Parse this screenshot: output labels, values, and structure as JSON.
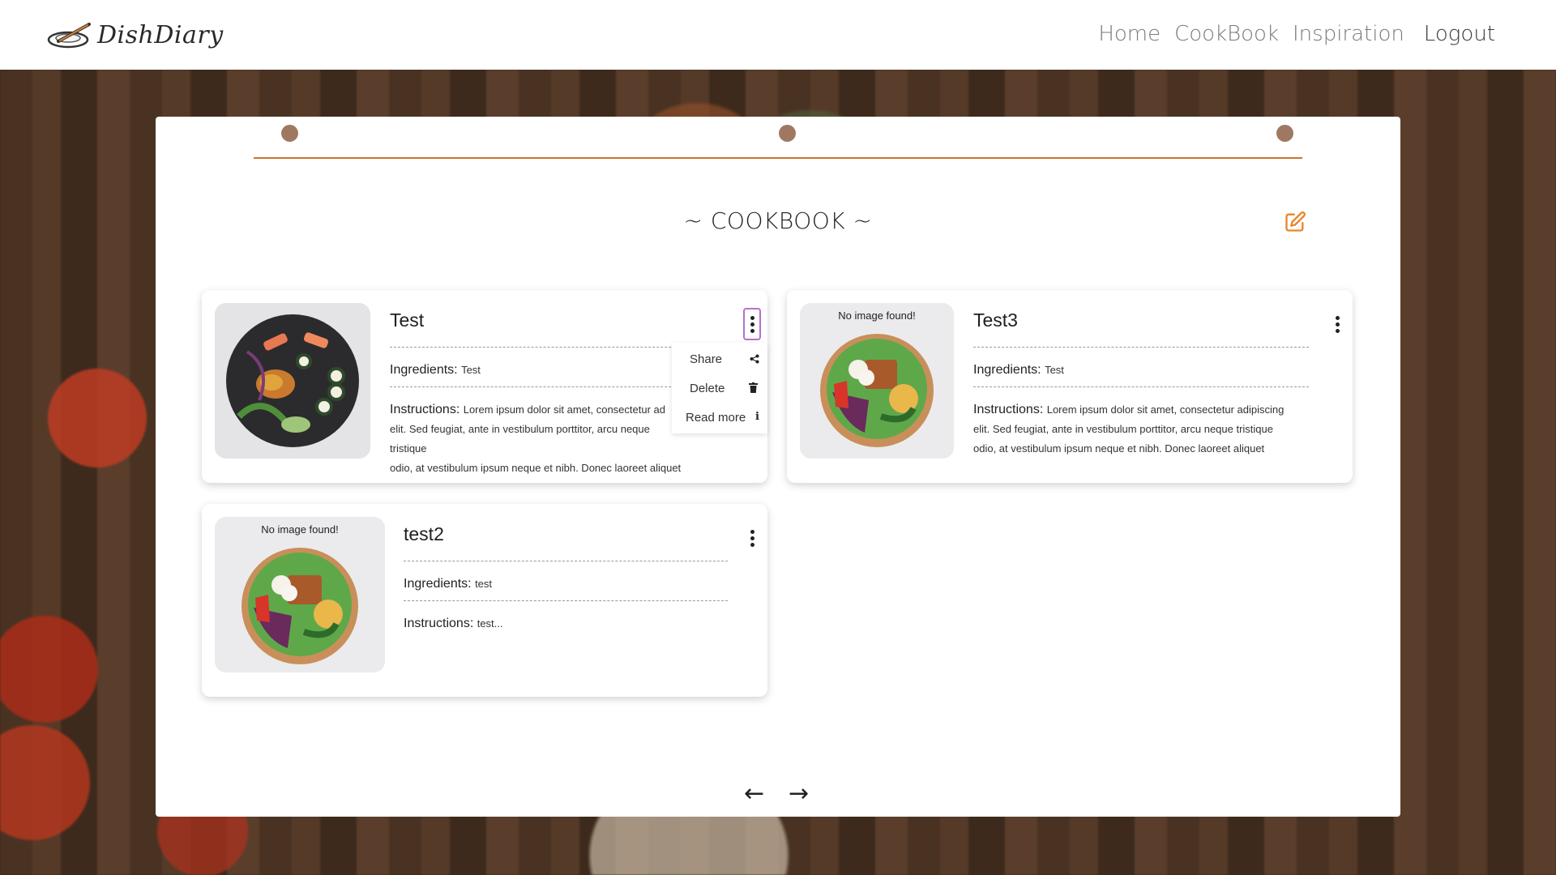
{
  "brand": {
    "name": "DishDiary"
  },
  "nav": {
    "home": "Home",
    "cookbook": "CookBook",
    "inspiration": "Inspiration",
    "logout": "Logout"
  },
  "page": {
    "title": "~ COOKBOOK ~"
  },
  "recipes": [
    {
      "title": "Test",
      "ingredients_label": "Ingredients:",
      "ingredients": "Test",
      "instructions_label": "Instructions:",
      "instructions_line1": "Lorem ipsum dolor sit amet, consectetur ad",
      "instructions_line2": "elit. Sed feugiat, ante in vestibulum porttitor, arcu neque tristique",
      "instructions_line3": "odio, at vestibulum ipsum neque et nibh. Donec laoreet aliquet",
      "image_note": ""
    },
    {
      "title": "Test3",
      "ingredients_label": "Ingredients:",
      "ingredients": "Test",
      "instructions_label": "Instructions:",
      "instructions_line1": "Lorem ipsum dolor sit amet, consectetur adipiscing",
      "instructions_line2": "elit. Sed feugiat, ante in vestibulum porttitor, arcu neque tristique",
      "instructions_line3": "odio, at vestibulum ipsum neque et nibh. Donec laoreet aliquet",
      "image_note": "No image found!"
    },
    {
      "title": "test2",
      "ingredients_label": "Ingredients:",
      "ingredients": "test",
      "instructions_label": "Instructions:",
      "instructions_line1": "test...",
      "image_note": "No image found!"
    }
  ],
  "menu": {
    "share": "Share",
    "delete": "Delete",
    "read_more": "Read more"
  },
  "pager": {
    "prev": "←",
    "next": "→"
  },
  "colors": {
    "accent": "#c9742d",
    "edit_icon": "#e8852a",
    "ring": "#a07862",
    "focus": "#b572c9"
  }
}
